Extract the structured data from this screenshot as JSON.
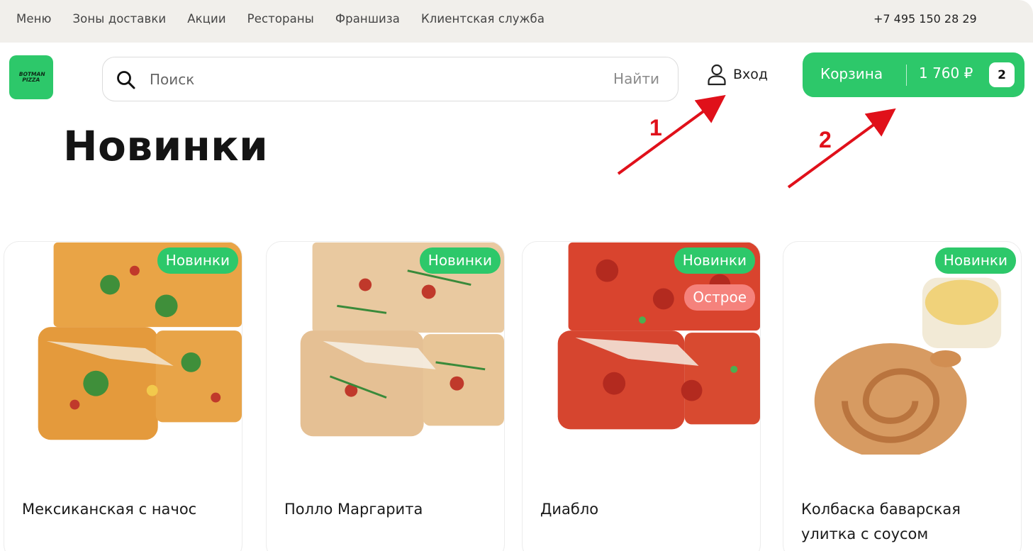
{
  "topnav": {
    "items": [
      "Меню",
      "Зоны доставки",
      "Акции",
      "Рестораны",
      "Франшиза",
      "Клиентская служба"
    ],
    "phone": "+7 495 150 28 29"
  },
  "logo": {
    "text_line1": "BOTMAN",
    "text_line2": "PIZZA"
  },
  "search": {
    "placeholder": "Поиск",
    "button": "Найти"
  },
  "login": {
    "label": "Вход"
  },
  "cart": {
    "label": "Корзина",
    "sum": "1 760 ₽",
    "count": "2"
  },
  "page": {
    "title": "Новинки"
  },
  "annotations": {
    "arrow1": "1",
    "arrow2": "2"
  },
  "products": [
    {
      "name": "Мексиканская с начос",
      "tags": [
        "Новинки"
      ]
    },
    {
      "name": "Полло Маргарита",
      "tags": [
        "Новинки"
      ]
    },
    {
      "name": "Диабло",
      "tags": [
        "Новинки",
        "Острое"
      ]
    },
    {
      "name": "Колбаска баварская улитка с соусом",
      "tags": [
        "Новинки"
      ]
    }
  ],
  "colors": {
    "accent": "#2dc86a",
    "spicy": "#f5827c",
    "topbar": "#f1efeb",
    "annotation": "#e0101a"
  }
}
